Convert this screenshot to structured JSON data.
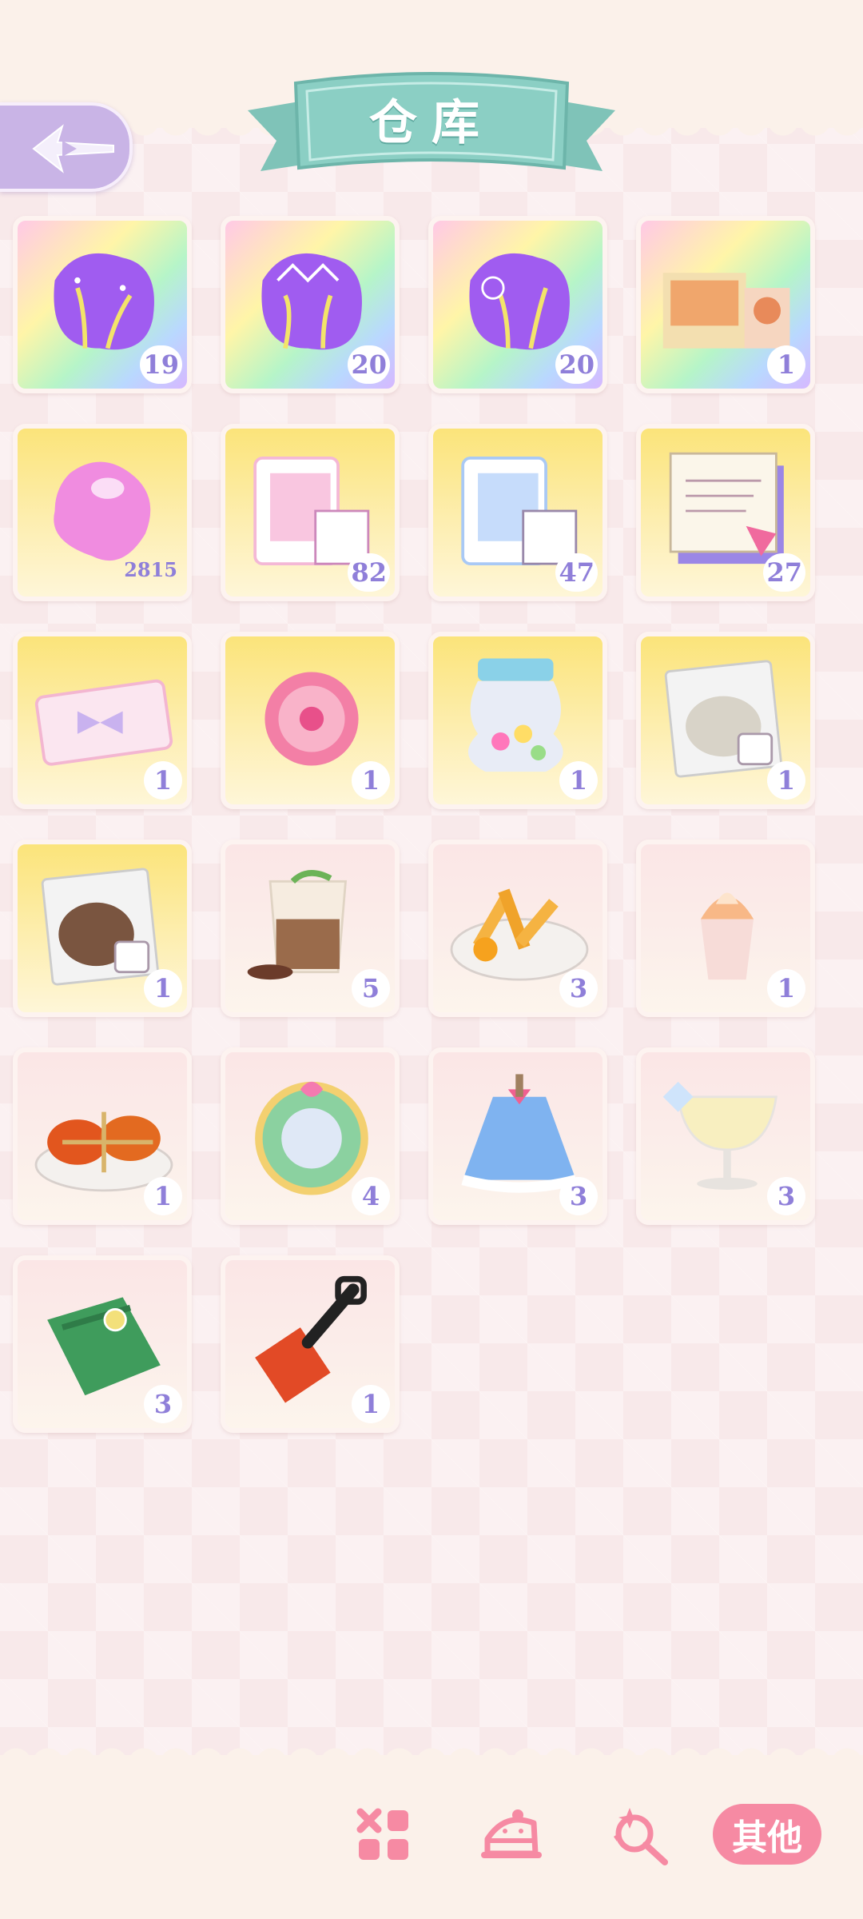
{
  "header": {
    "title": "仓库",
    "back_icon": "back-arrow-icon"
  },
  "colors": {
    "accent_pink": "#f68aa3",
    "banner_teal": "#8bcfc4",
    "count_purple": "#8f7fd9"
  },
  "items": [
    {
      "name": "firework-light-pink",
      "count": "19",
      "bg": "rainbow"
    },
    {
      "name": "firework-light-crown",
      "count": "20",
      "bg": "rainbow"
    },
    {
      "name": "firework-light-blue",
      "count": "20",
      "bg": "rainbow"
    },
    {
      "name": "gift-box-set",
      "count": "1",
      "bg": "rainbow"
    },
    {
      "name": "pink-crystal",
      "count": "2815",
      "bg": "yellow"
    },
    {
      "name": "pink-card-pack",
      "count": "82",
      "bg": "yellow"
    },
    {
      "name": "blue-card-pack",
      "count": "47",
      "bg": "yellow"
    },
    {
      "name": "recipe-scroll",
      "count": "27",
      "bg": "yellow"
    },
    {
      "name": "ticket",
      "count": "1",
      "bg": "yellow"
    },
    {
      "name": "pink-badge",
      "count": "1",
      "bg": "yellow"
    },
    {
      "name": "candy-jar",
      "count": "1",
      "bg": "yellow"
    },
    {
      "name": "white-flour-bag",
      "count": "1",
      "bg": "yellow"
    },
    {
      "name": "cocoa-bag",
      "count": "1",
      "bg": "yellow"
    },
    {
      "name": "matcha-latte-cup",
      "count": "5",
      "bg": "pink"
    },
    {
      "name": "orange-fries-plate",
      "count": "3",
      "bg": "pink"
    },
    {
      "name": "ice-cream-cup",
      "count": "1",
      "bg": "pink"
    },
    {
      "name": "crab-platter",
      "count": "1",
      "bg": "pink"
    },
    {
      "name": "cloud-wreath",
      "count": "4",
      "bg": "pink"
    },
    {
      "name": "blue-cape",
      "count": "3",
      "bg": "pink"
    },
    {
      "name": "cocktail-glass",
      "count": "3",
      "bg": "pink"
    },
    {
      "name": "green-scarf",
      "count": "3",
      "bg": "pink"
    },
    {
      "name": "red-shovel",
      "count": "1",
      "bg": "pink"
    }
  ],
  "nav": {
    "tabs": [
      {
        "icon": "grid-icon"
      },
      {
        "icon": "cake-icon"
      },
      {
        "icon": "magic-wand-icon"
      }
    ],
    "active_label": "其他"
  }
}
